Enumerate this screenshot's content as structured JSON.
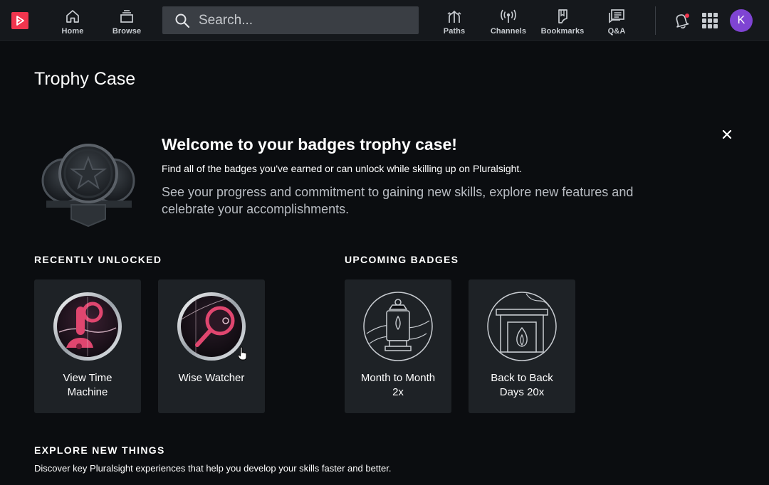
{
  "nav": {
    "items": [
      {
        "label": "Home",
        "icon": "home-icon"
      },
      {
        "label": "Browse",
        "icon": "browse-icon"
      },
      {
        "label": "Paths",
        "icon": "paths-icon"
      },
      {
        "label": "Channels",
        "icon": "channels-icon"
      },
      {
        "label": "Bookmarks",
        "icon": "bookmark-icon"
      },
      {
        "label": "Q&A",
        "icon": "qa-icon"
      }
    ],
    "search_placeholder": "Search...",
    "avatar_initial": "K",
    "has_notification": true
  },
  "page": {
    "title": "Trophy Case"
  },
  "welcome": {
    "title": "Welcome to your badges trophy case!",
    "subtitle": "Find all of the badges you've earned or can unlock while skilling up on Pluralsight.",
    "body": "See your progress and commitment to gaining new skills, explore new features and celebrate your accomplishments."
  },
  "recent": {
    "heading": "RECENTLY UNLOCKED",
    "badges": [
      {
        "name": "View Time Machine",
        "icon": "time-machine-icon"
      },
      {
        "name": "Wise Watcher",
        "icon": "magnifier-icon"
      }
    ]
  },
  "upcoming": {
    "heading": "UPCOMING BADGES",
    "badges": [
      {
        "name": "Month to Month 2x",
        "icon": "lantern-icon"
      },
      {
        "name": "Back to Back Days 20x",
        "icon": "fireplace-icon"
      }
    ]
  },
  "explore": {
    "heading": "EXPLORE NEW THINGS",
    "subtitle": "Discover key Pluralsight experiences that help you develop your skills faster and better."
  },
  "colors": {
    "brand": "#f0354e",
    "avatar": "#7f44d3",
    "card": "#1e2226",
    "background": "#0b0d10"
  }
}
